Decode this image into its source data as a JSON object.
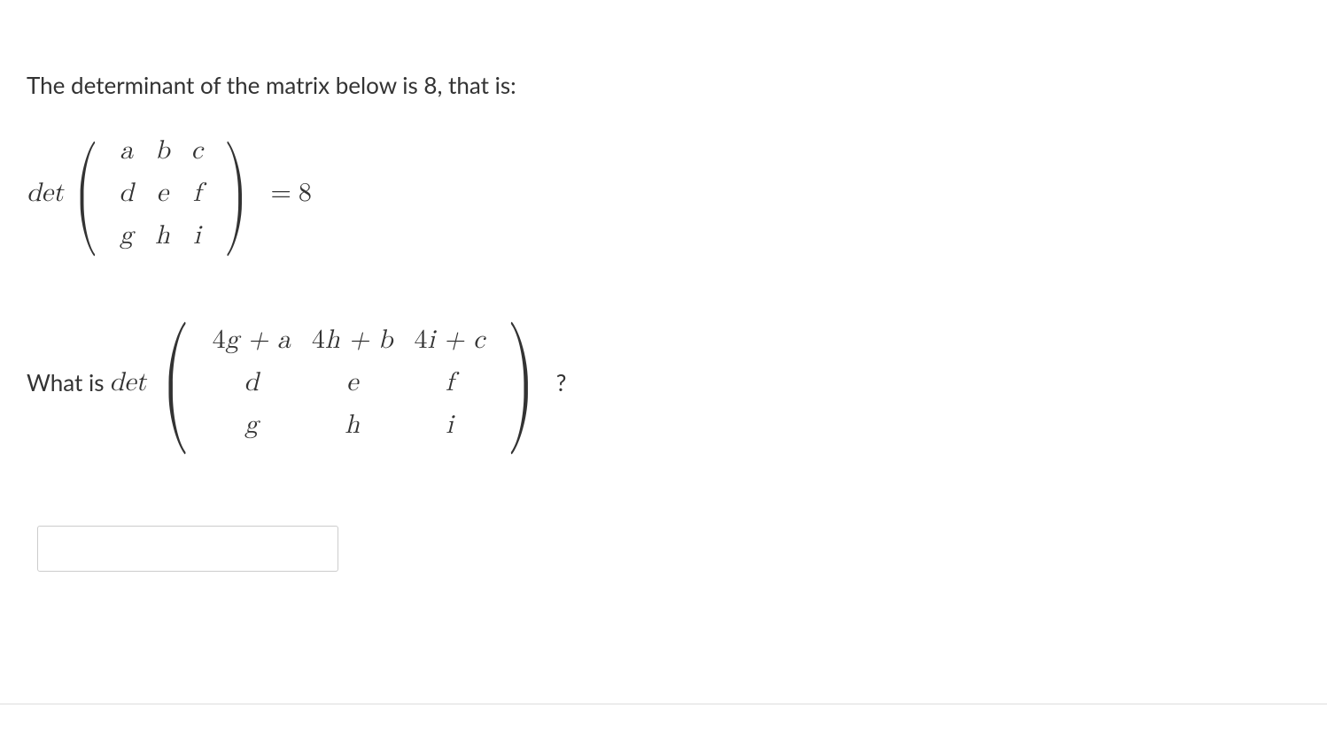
{
  "prompt_line": "The determinant of the matrix below is 8, that is:",
  "det_label": "det",
  "given_matrix": {
    "rows": [
      [
        "a",
        "b",
        "c"
      ],
      [
        "d",
        "e",
        "f"
      ],
      [
        "g",
        "h",
        "i"
      ]
    ]
  },
  "equals": "=",
  "det_value": "8",
  "question_prefix": "What is ",
  "question_matrix": {
    "rows": [
      [
        "4g + a",
        "4h + b",
        "4i + c"
      ],
      [
        "d",
        "e",
        "f"
      ],
      [
        "g",
        "h",
        "i"
      ]
    ]
  },
  "question_suffix": "?",
  "answer_value": ""
}
